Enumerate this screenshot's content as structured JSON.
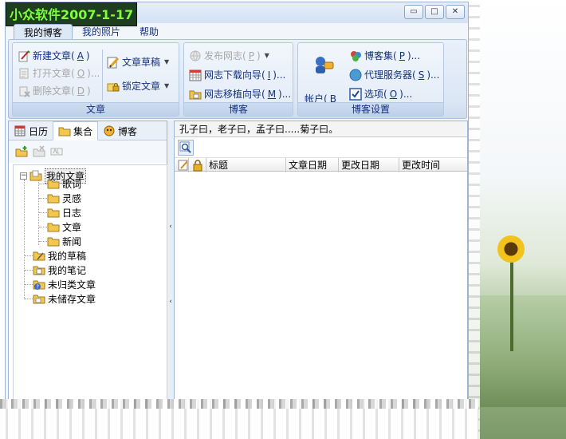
{
  "title_badge": "小众软件2007-1-17",
  "window_controls": {
    "minimize": "▭",
    "maximize": "□",
    "close": "✕"
  },
  "ribbon_tabs": [
    {
      "label": "我的博客",
      "active": true
    },
    {
      "label": "我的照片",
      "active": false
    },
    {
      "label": "帮助",
      "active": false
    }
  ],
  "groups": {
    "article": {
      "caption": "文章",
      "new_article": {
        "text": "新建文章(",
        "key": "A",
        "tail": ")"
      },
      "open_article": {
        "text": "打开文章(",
        "key": "O",
        "tail": ")..."
      },
      "delete_article": {
        "text": "删除文章(",
        "key": "D",
        "tail": ")"
      },
      "draft": "文章草稿",
      "lock": "锁定文章"
    },
    "blog": {
      "caption": "博客",
      "publish": {
        "text": "发布网志(",
        "key": "P",
        "tail": ")"
      },
      "download_wizard": {
        "text": "网志下载向导(",
        "key": "I",
        "tail": ")..."
      },
      "migrate_wizard": {
        "text": "网志移植向导(",
        "key": "M",
        "tail": ")..."
      }
    },
    "settings": {
      "caption": "博客设置",
      "account": {
        "text": "帐户(",
        "key": "B"
      },
      "blog_set": {
        "text": "博客集(",
        "key": "P",
        "tail": ")..."
      },
      "proxy": {
        "text": "代理服务器(",
        "key": "S",
        "tail": ")..."
      },
      "options": {
        "text": "选项(",
        "key": "O",
        "tail": ")..."
      }
    }
  },
  "panel_tabs": [
    {
      "label": "日历",
      "icon": "calendar-icon",
      "active": false
    },
    {
      "label": "集合",
      "icon": "folder-icon",
      "active": true
    },
    {
      "label": "博客",
      "icon": "blog-icon",
      "active": false
    }
  ],
  "tree": {
    "root": "我的文章",
    "children": [
      "歌词",
      "灵感",
      "日志",
      "文章",
      "新闻"
    ],
    "others": [
      "我的草稿",
      "我的笔记",
      "未归类文章",
      "未储存文章"
    ]
  },
  "splitter": {
    "arrow": "‹"
  },
  "motto": "孔子曰，老子曰，孟子曰.....菊子曰。",
  "columns": [
    "标题",
    "文章日期",
    "更改日期",
    "更改时间"
  ],
  "colors": {
    "accent": "#15317e",
    "badge_bg": "#1f3d1f",
    "badge_text": "#7dff3a"
  }
}
